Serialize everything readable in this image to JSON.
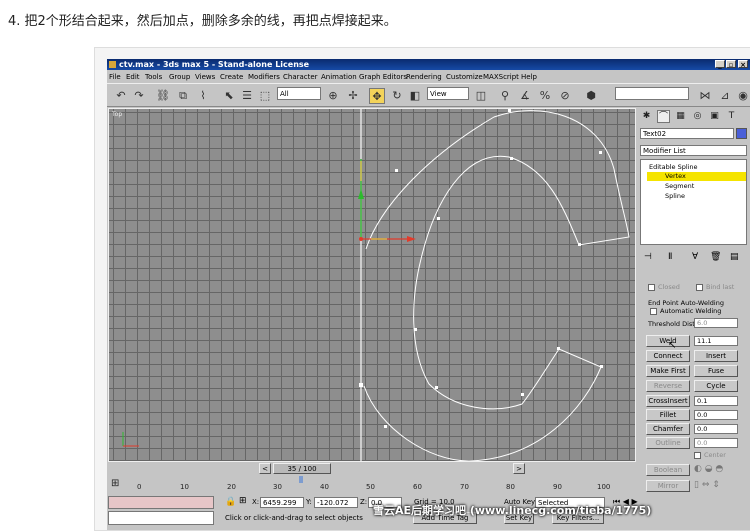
{
  "instruction": "4. 把2个形结合起来，然后加点，删除多余的线，再把点焊接起来。",
  "window": {
    "title": "ctv.max - 3ds max 5 - Stand-alone License",
    "min": "_",
    "max": "▫",
    "close": "×"
  },
  "menu": [
    "File",
    "Edit",
    "Tools",
    "Group",
    "Views",
    "Create",
    "Modifiers",
    "Character",
    "Animation",
    "Graph Editors",
    "Rendering",
    "Customize",
    "MAXScript",
    "Help"
  ],
  "toolbar": {
    "selection_filter": "All",
    "ref_coord": "View"
  },
  "viewport": {
    "label": "Top"
  },
  "command_panel": {
    "object_name": "Text02",
    "object_color": "#4a5fd8",
    "modifier_list": "Modifier List",
    "stack": [
      "Editable Spline",
      "Vertex",
      "Segment",
      "Spline"
    ],
    "closed": "Closed",
    "bind_last": "Bind last",
    "endpoint_group": "End Point Auto-Welding",
    "auto_welding": "Automatic Welding",
    "threshold_label": "Threshold Dist",
    "threshold_value": "6.0",
    "weld": "Weld",
    "weld_value": "11.1",
    "connect": "Connect",
    "insert": "Insert",
    "make_first": "Make First",
    "fuse": "Fuse",
    "reverse": "Reverse",
    "cycle": "Cycle",
    "crossinsert": "CrossInsert",
    "crossinsert_value": "0.1",
    "fillet": "Fillet",
    "fillet_value": "0.0",
    "chamfer": "Chamfer",
    "chamfer_value": "0.0",
    "outline": "Outline",
    "outline_value": "0.0",
    "center": "Center",
    "boolean": "Boolean",
    "mirror": "Mirror"
  },
  "timeline": {
    "frame": "35 / 100",
    "ticks": [
      "0",
      "10",
      "20",
      "30",
      "40",
      "50",
      "60",
      "70",
      "80",
      "90",
      "100"
    ]
  },
  "status": {
    "x": "6459.299",
    "y": "-120.072",
    "z": "0.0",
    "grid": "Grid = 10.0",
    "auto_key": "Auto Key",
    "set_key": "Set Key",
    "selected": "Selected",
    "key_filters": "Key Filters...",
    "prompt": "Click or click-and-drag to select objects",
    "add_time_tag": "Add Time Tag"
  },
  "watermark": "雪云AE后期学习吧 (www.linecg.com/tieba/1775)"
}
